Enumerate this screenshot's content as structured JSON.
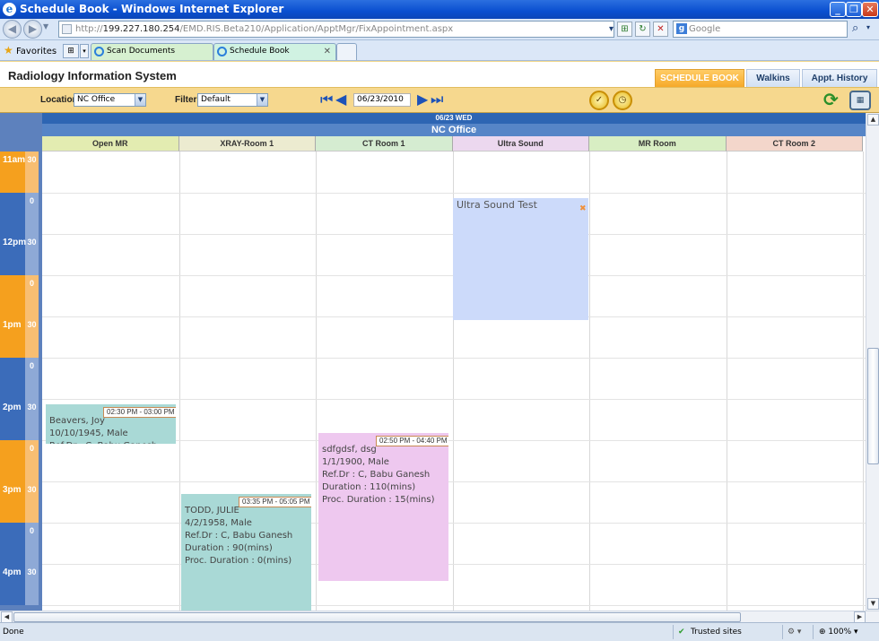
{
  "window": {
    "title": "Schedule Book - Windows Internet Explorer"
  },
  "browser": {
    "url_prefix": "http://",
    "url_host": "199.227.180.254",
    "url_path": "/EMD.RIS.Beta210/Application/ApptMgr/FixAppointment.aspx",
    "search_placeholder": "Google",
    "favorites_label": "Favorites",
    "tabs": [
      {
        "label": "Scan Documents",
        "active": false
      },
      {
        "label": "Schedule Book",
        "active": true
      }
    ],
    "status_text": "Done",
    "zone_text": "Trusted sites",
    "zoom_text": "100%"
  },
  "app": {
    "title": "Radiology Information System",
    "tabs": [
      {
        "label": "SCHEDULE BOOK",
        "active": true
      },
      {
        "label": "Walkins",
        "active": false
      },
      {
        "label": "Appt. History",
        "active": false
      }
    ]
  },
  "toolbar": {
    "location_label": "Location",
    "location_value": "NC Office",
    "filter_label": "Filter",
    "filter_value": "Default",
    "date_value": "06/23/2010"
  },
  "calendar": {
    "date_header": "06/23 WED",
    "office": "NC Office",
    "rooms": [
      {
        "name": "Open MR",
        "color": "#e3ecb1"
      },
      {
        "name": "XRAY-Room 1",
        "color": "#ecebd0"
      },
      {
        "name": "CT Room 1",
        "color": "#d5ecd1"
      },
      {
        "name": "Ultra Sound",
        "color": "#ecd8ef"
      },
      {
        "name": "MR Room",
        "color": "#d8eec3"
      },
      {
        "name": "CT Room 2",
        "color": "#f3d6cb"
      }
    ],
    "time_rows": [
      {
        "hour": "11am",
        "minute": "30",
        "color": "orange"
      },
      {
        "hour": "",
        "minute": "0",
        "color": "blue"
      },
      {
        "hour": "12pm",
        "minute": "30",
        "color": "blue"
      },
      {
        "hour": "",
        "minute": "0",
        "color": "orange"
      },
      {
        "hour": "1pm",
        "minute": "30",
        "color": "orange"
      },
      {
        "hour": "",
        "minute": "0",
        "color": "blue"
      },
      {
        "hour": "2pm",
        "minute": "30",
        "color": "blue"
      },
      {
        "hour": "",
        "minute": "0",
        "color": "orange"
      },
      {
        "hour": "3pm",
        "minute": "30",
        "color": "orange"
      },
      {
        "hour": "",
        "minute": "0",
        "color": "blue"
      },
      {
        "hour": "4pm",
        "minute": "30",
        "color": "blue"
      }
    ],
    "appointments": [
      {
        "room": "Ultra Sound",
        "title": "Ultra Sound Test",
        "time": "",
        "color": "#ccdafa",
        "lines": []
      },
      {
        "room": "Open MR",
        "title": "Beavers, Joy",
        "time": "02:30 PM - 03:00 PM",
        "color": "#a9d9d6",
        "lines": [
          "10/10/1945, Male",
          "Ref.Dr : C, Babu Ganesh"
        ]
      },
      {
        "room": "CT Room 1",
        "title": "sdfgdsf, dsg",
        "time": "02:50 PM - 04:40 PM",
        "color": "#eec8ef",
        "lines": [
          "1/1/1900, Male",
          "Ref.Dr : C, Babu Ganesh",
          "Duration : 110(mins)",
          "Proc. Duration :  15(mins)"
        ]
      },
      {
        "room": "XRAY-Room 1",
        "title": "TODD, JULIE",
        "time": "03:35 PM - 05:05 PM",
        "color": "#a9d9d6",
        "lines": [
          "4/2/1958, Male",
          "Ref.Dr : C, Babu Ganesh",
          "Duration : 90(mins)",
          "Proc. Duration :  0(mins)"
        ]
      }
    ]
  }
}
